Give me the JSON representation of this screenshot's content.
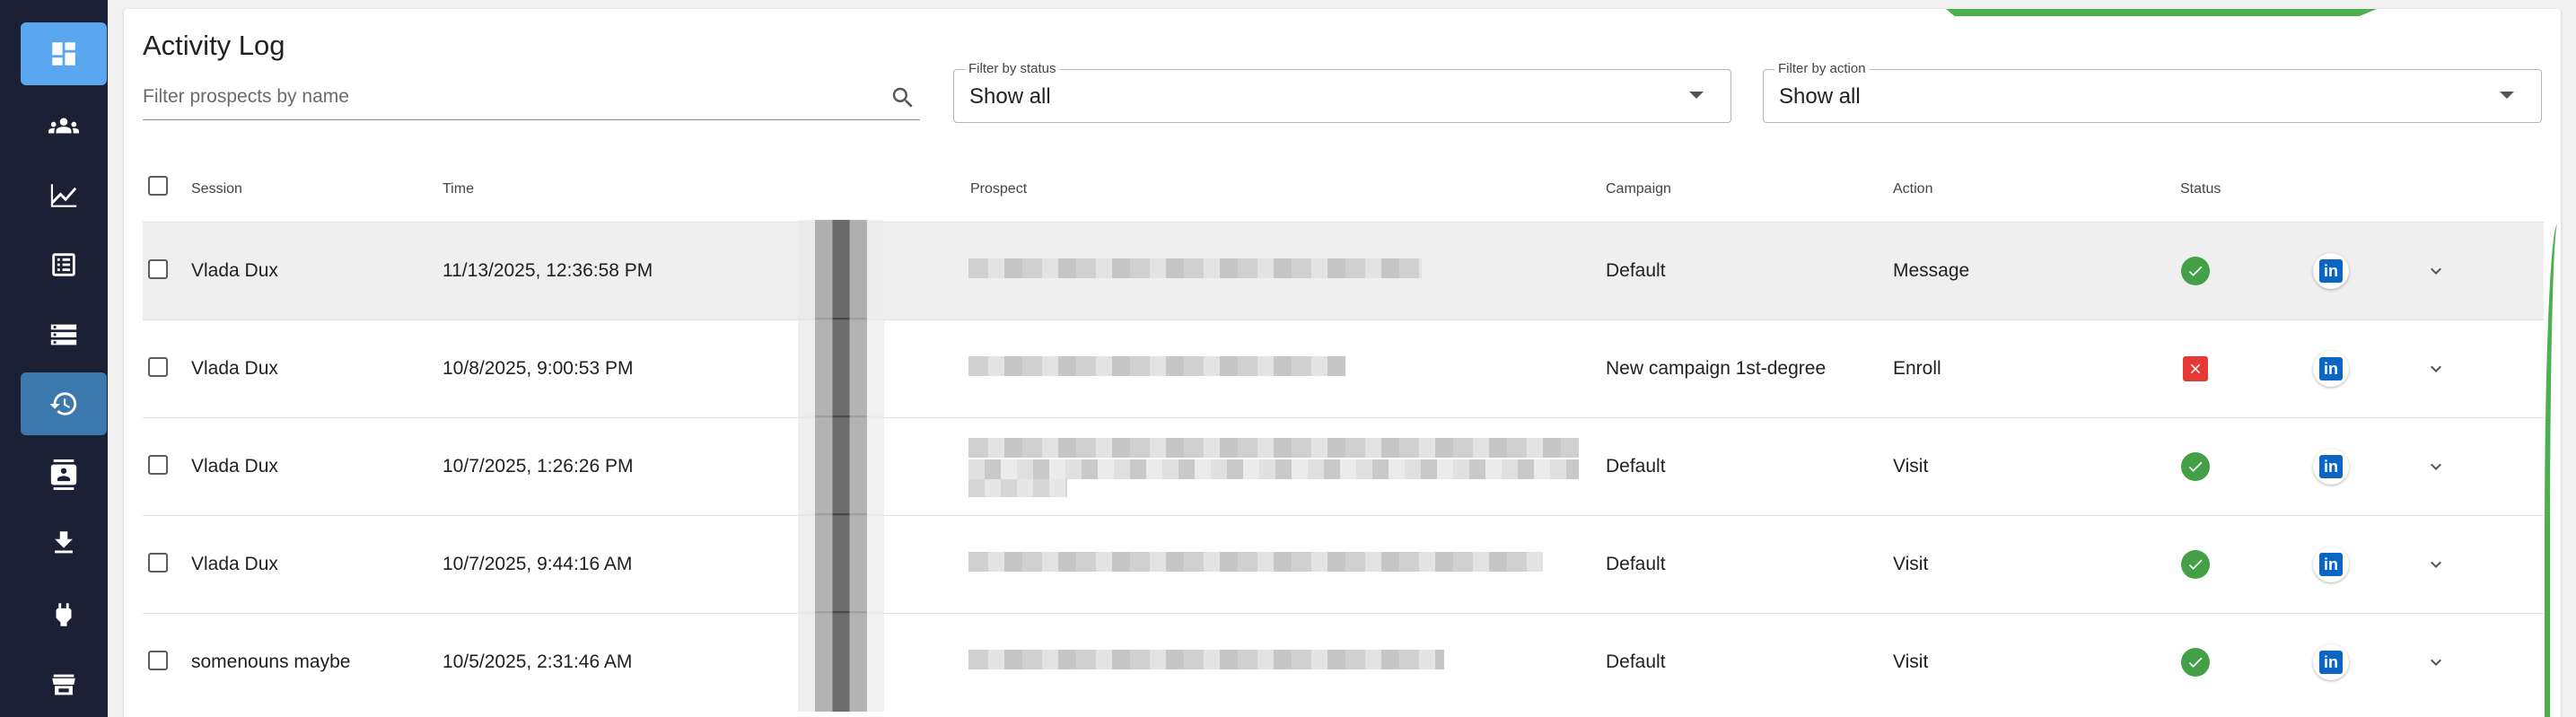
{
  "sidebar": {
    "items": [
      {
        "icon": "dashboard-icon",
        "state": "highlight"
      },
      {
        "icon": "people-icon",
        "state": "normal"
      },
      {
        "icon": "analytics-icon",
        "state": "normal"
      },
      {
        "icon": "list-icon",
        "state": "normal"
      },
      {
        "icon": "inbox-icon",
        "state": "normal"
      },
      {
        "icon": "history-icon",
        "state": "active"
      },
      {
        "icon": "contact-card-icon",
        "state": "normal"
      },
      {
        "icon": "download-icon",
        "state": "normal"
      },
      {
        "icon": "plug-icon",
        "state": "normal"
      },
      {
        "icon": "store-icon",
        "state": "normal"
      }
    ]
  },
  "header": {
    "title": "Activity Log",
    "search_placeholder": "Filter prospects by name",
    "status_filter": {
      "label": "Filter by status",
      "value": "Show all"
    },
    "action_filter": {
      "label": "Filter by action",
      "value": "Show all"
    }
  },
  "table": {
    "columns": [
      "Session",
      "Time",
      "Prospect",
      "Campaign",
      "Action",
      "Status"
    ],
    "rows": [
      {
        "session": "Vlada Dux",
        "time": "11/13/2025, 12:36:58 PM",
        "campaign": "Default",
        "action": "Message",
        "status": "success"
      },
      {
        "session": "Vlada Dux",
        "time": "10/8/2025, 9:00:53 PM",
        "campaign": "New campaign 1st-degree",
        "action": "Enroll",
        "status": "failed"
      },
      {
        "session": "Vlada Dux",
        "time": "10/7/2025, 1:26:26 PM",
        "campaign": "Default",
        "action": "Visit",
        "status": "success"
      },
      {
        "session": "Vlada Dux",
        "time": "10/7/2025, 9:44:16 AM",
        "campaign": "Default",
        "action": "Visit",
        "status": "success"
      },
      {
        "session": "somenouns maybe",
        "time": "10/5/2025, 2:31:46 AM",
        "campaign": "Default",
        "action": "Visit",
        "status": "success"
      }
    ]
  },
  "colors": {
    "sidebar_bg": "#1c2035",
    "active_item": "#3a78ad",
    "success": "#43a047",
    "failed": "#e53935",
    "linkedin": "#0a66c2",
    "accent_green": "#4caf50"
  }
}
